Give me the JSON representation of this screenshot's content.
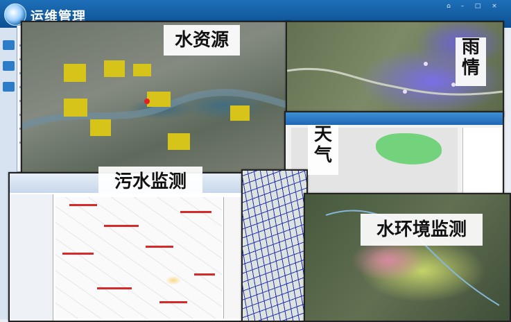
{
  "app": {
    "title": "运维管理",
    "window_controls": [
      "–",
      "□",
      "×",
      "⌂"
    ]
  },
  "panels": {
    "water_resources": {
      "label": "水资源"
    },
    "rainfall": {
      "label": "雨情"
    },
    "weather": {
      "label": "天气"
    },
    "sewage_monitoring": {
      "label": "污水监测"
    },
    "water_environment_monitoring": {
      "label": "水环境监测"
    }
  },
  "colors": {
    "header_blue": "#1d6fb8",
    "rain_purple": "#7a6ee8",
    "weather_green": "#5fd06a",
    "pipe_blue": "#2230b6"
  },
  "icons": [
    "app-logo-icon",
    "minimize-icon",
    "maximize-icon",
    "close-icon",
    "home-icon"
  ]
}
